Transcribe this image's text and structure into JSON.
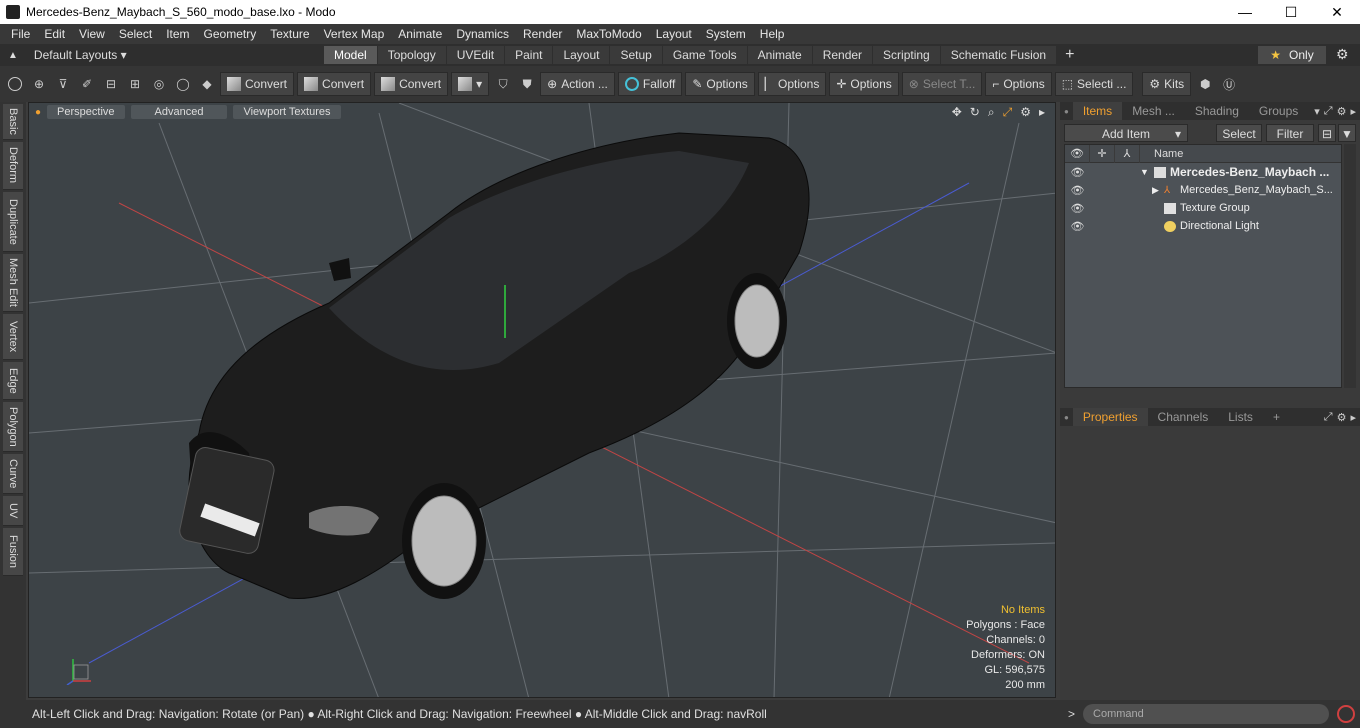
{
  "window": {
    "title": "Mercedes-Benz_Maybach_S_560_modo_base.lxo - Modo",
    "min": "—",
    "max": "☐",
    "close": "✕"
  },
  "menu": [
    "File",
    "Edit",
    "View",
    "Select",
    "Item",
    "Geometry",
    "Texture",
    "Vertex Map",
    "Animate",
    "Dynamics",
    "Render",
    "MaxToModo",
    "Layout",
    "System",
    "Help"
  ],
  "layouts": {
    "label": "Default Layouts ▾"
  },
  "layout_tabs": [
    {
      "label": "Model",
      "active": true
    },
    {
      "label": "Topology"
    },
    {
      "label": "UVEdit"
    },
    {
      "label": "Paint"
    },
    {
      "label": "Layout"
    },
    {
      "label": "Setup"
    },
    {
      "label": "Game Tools"
    },
    {
      "label": "Animate"
    },
    {
      "label": "Render"
    },
    {
      "label": "Scripting"
    },
    {
      "label": "Schematic Fusion"
    }
  ],
  "only_label": "Only",
  "toolbar": {
    "convert1": "Convert",
    "convert2": "Convert",
    "convert3": "Convert",
    "action": "Action ...",
    "falloff": "Falloff",
    "options1": "Options",
    "options2": "Options",
    "options3": "Options",
    "select_t": "Select T...",
    "options4": "Options",
    "selecti": "Selecti ...",
    "kits": "Kits"
  },
  "left_tabs": [
    "Basic",
    "Deform",
    "Duplicate",
    "Mesh Edit",
    "Vertex",
    "Edge",
    "Polygon",
    "Curve",
    "UV",
    "Fusion"
  ],
  "viewport": {
    "tabs": [
      "Perspective",
      "Advanced",
      "Viewport Textures"
    ],
    "info": {
      "selection": "No Items",
      "polygons": "Polygons : Face",
      "channels": "Channels: 0",
      "deformers": "Deformers: ON",
      "gl": "GL: 596,575",
      "scale": "200 mm"
    }
  },
  "status": "Alt-Left Click and Drag: Navigation: Rotate (or Pan) ● Alt-Right Click and Drag: Navigation: Freewheel ● Alt-Middle Click and Drag: navRoll",
  "items_panel": {
    "tabs": [
      "Items",
      "Mesh ...",
      "Shading",
      "Groups"
    ],
    "add_item": "Add Item",
    "select": "Select",
    "filter": "Filter",
    "name_header": "Name",
    "rows": [
      {
        "label": "Mercedes-Benz_Maybach ...",
        "bold": true
      },
      {
        "label": "Mercedes_Benz_Maybach_S..."
      },
      {
        "label": "Texture Group"
      },
      {
        "label": "Directional Light"
      }
    ]
  },
  "props_panel": {
    "tabs": [
      "Properties",
      "Channels",
      "Lists"
    ]
  },
  "command": {
    "placeholder": "Command",
    "prompt": ">"
  }
}
